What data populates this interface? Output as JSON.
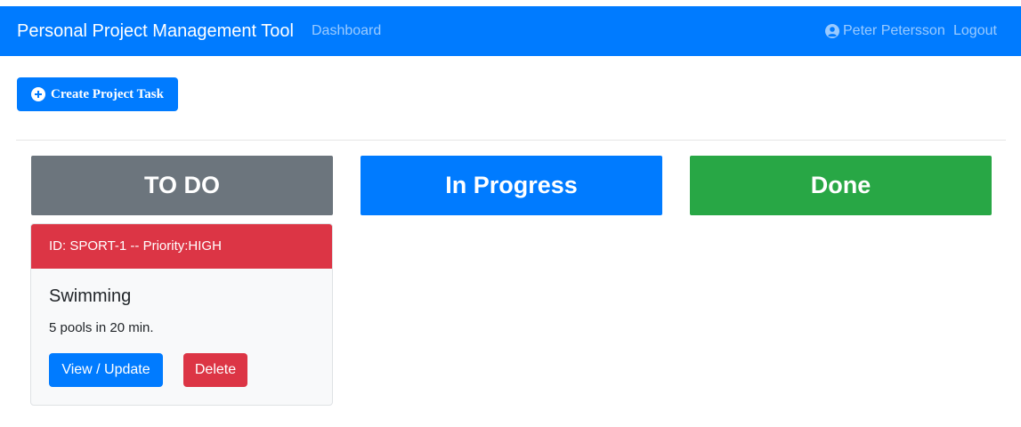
{
  "navbar": {
    "brand": "Personal Project Management Tool",
    "dashboard_link": "Dashboard",
    "user_name": "Peter Petersson",
    "logout_link": "Logout",
    "user_icon": "user-circle-icon"
  },
  "toolbar": {
    "create_label": "Create Project Task",
    "create_icon": "plus-circle-icon"
  },
  "board": {
    "columns": [
      {
        "label": "TO DO",
        "color": "#6c757d"
      },
      {
        "label": "In Progress",
        "color": "#007bff"
      },
      {
        "label": "Done",
        "color": "#28a745"
      }
    ],
    "todo_tasks": [
      {
        "header": "ID: SPORT-1 -- Priority:HIGH",
        "priority_color": "#dc3545",
        "title": "Swimming",
        "description": "5 pools in 20 min.",
        "view_label": "View / Update",
        "delete_label": "Delete"
      }
    ]
  },
  "colors": {
    "primary": "#007bff",
    "danger": "#dc3545",
    "success": "#28a745",
    "secondary": "#6c757d"
  }
}
